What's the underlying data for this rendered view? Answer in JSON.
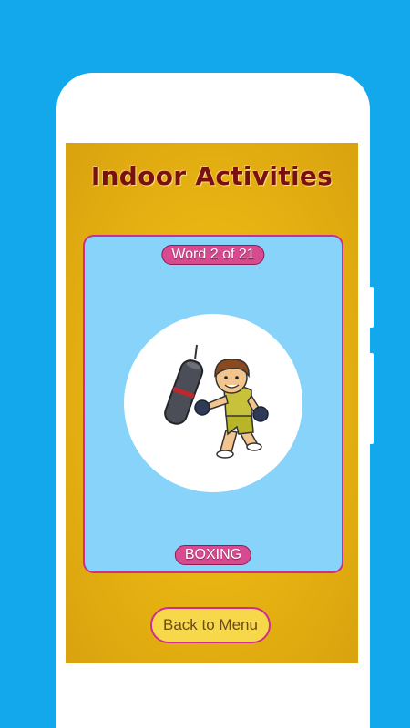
{
  "header": {
    "title": "Indoor Activities"
  },
  "card": {
    "counter": "Word 2 of 21",
    "word": "BOXING",
    "illustration": "boxing-boy-illustration"
  },
  "footer": {
    "menu_label": "Back to Menu"
  },
  "colors": {
    "background": "#13a8ec",
    "screen": "#e9b512",
    "card": "#87d3fa",
    "pill": "#d74a8f",
    "title": "#7a1010"
  }
}
